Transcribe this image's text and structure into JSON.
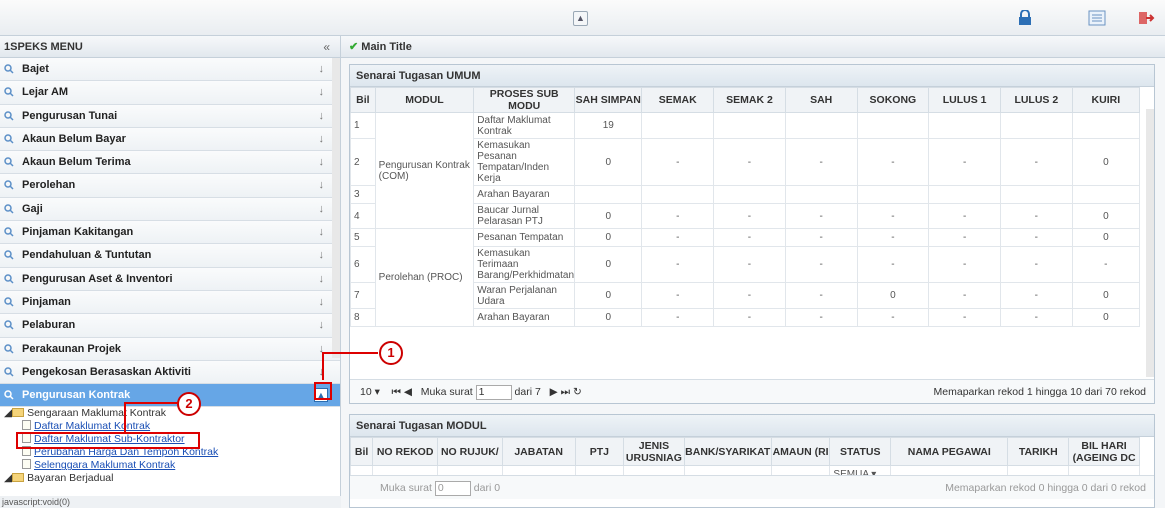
{
  "sidebar": {
    "header": "1SPEKS MENU",
    "collapse": "«",
    "items": [
      {
        "label": "Bajet"
      },
      {
        "label": "Lejar AM"
      },
      {
        "label": "Pengurusan Tunai"
      },
      {
        "label": "Akaun Belum Bayar"
      },
      {
        "label": "Akaun Belum Terima"
      },
      {
        "label": "Perolehan"
      },
      {
        "label": "Gaji"
      },
      {
        "label": "Pinjaman Kakitangan"
      },
      {
        "label": "Pendahuluan & Tuntutan"
      },
      {
        "label": "Pengurusan Aset & Inventori"
      },
      {
        "label": "Pinjaman"
      },
      {
        "label": "Pelaburan"
      },
      {
        "label": "Perakaunan Projek"
      },
      {
        "label": "Pengekosan Berasaskan Aktiviti"
      },
      {
        "label": "Pengurusan Kontrak"
      }
    ],
    "tree": {
      "folder1": "Sengaraan Maklumat Kontrak",
      "children": [
        "Daftar Maklumat Kontrak",
        "Daftar Maklumat Sub-Kontraktor",
        "Perubahan Harga Dan Tempoh Kontrak",
        "Selenggara Maklumat Kontrak"
      ],
      "folder2": "Bayaran Berjadual"
    },
    "status": "javascript:void(0)"
  },
  "main": {
    "title": "Main Title",
    "umum": {
      "title": "Senarai Tugasan UMUM",
      "headers": [
        "Bil",
        "MODUL",
        "PROSES SUB MODU",
        "SAH SIMPAN",
        "SEMAK",
        "SEMAK 2",
        "SAH",
        "SOKONG",
        "LULUS 1",
        "LULUS 2",
        "KUIRI"
      ],
      "modules": [
        "Pengurusan Kontrak (COM)",
        "Perolehan (PROC)"
      ],
      "rows": [
        {
          "bil": "1",
          "proses": "Daftar Maklumat Kontrak",
          "c": [
            "19",
            "",
            "",
            "",
            "",
            "",
            "",
            ""
          ]
        },
        {
          "bil": "2",
          "proses": "Kemasukan Pesanan Tempatan/Inden Kerja",
          "c": [
            "0",
            "-",
            "-",
            "-",
            "-",
            "-",
            "-",
            "0"
          ]
        },
        {
          "bil": "3",
          "proses": "Arahan Bayaran",
          "c": [
            "",
            "",
            "",
            "",
            "",
            "",
            "",
            ""
          ]
        },
        {
          "bil": "4",
          "proses": "Baucar Jurnal Pelarasan PTJ",
          "c": [
            "0",
            "-",
            "-",
            "-",
            "-",
            "-",
            "-",
            "0"
          ]
        },
        {
          "bil": "5",
          "proses": "Pesanan Tempatan",
          "c": [
            "0",
            "-",
            "-",
            "-",
            "-",
            "-",
            "-",
            "0"
          ]
        },
        {
          "bil": "6",
          "proses": "Kemasukan Terimaan Barang/Perkhidmatan",
          "c": [
            "0",
            "-",
            "-",
            "-",
            "-",
            "-",
            "-",
            "-"
          ]
        },
        {
          "bil": "7",
          "proses": "Waran Perjalanan Udara",
          "c": [
            "0",
            "-",
            "-",
            "-",
            "0",
            "-",
            "-",
            "0"
          ]
        },
        {
          "bil": "8",
          "proses": "Arahan Bayaran",
          "c": [
            "0",
            "-",
            "-",
            "-",
            "-",
            "-",
            "-",
            "0"
          ]
        }
      ],
      "pager": {
        "size": "10",
        "page_label": "Muka surat",
        "page": "1",
        "of": "dari 7",
        "info": "Memaparkan rekod 1 hingga 10 dari 70 rekod"
      }
    },
    "modul": {
      "title": "Senarai Tugasan MODUL",
      "headers": [
        "Bil",
        "NO REKOD",
        "NO RUJUK/",
        "JABATAN",
        "PTJ",
        "JENIS URUSNIAG",
        "BANK/SYARIKAT",
        "AMAUN (RI",
        "STATUS",
        "NAMA PEGAWAI",
        "TARIKH",
        "BIL HARI (AGEING DC"
      ],
      "status_filter": "SEMUA",
      "pager": {
        "page_label": "Muka surat",
        "page": "0",
        "of": "dari 0",
        "info": "Memaparkan rekod 0 hingga 0 dari 0 rekod"
      }
    }
  },
  "callouts": [
    "1",
    "2"
  ],
  "colors": {
    "accent": "#66a6e6",
    "callout": "#cc0000"
  }
}
